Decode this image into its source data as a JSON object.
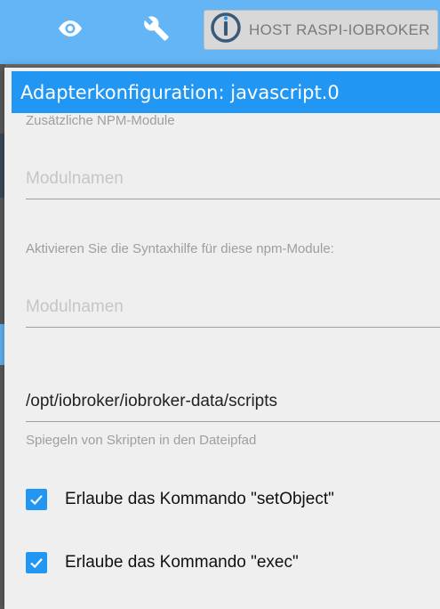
{
  "topbar": {
    "eye_icon": "eye-icon",
    "wrench_icon": "wrench-icon",
    "host_label": "HOST RASPI-IOBROKER",
    "host_logo": "iobroker-logo-icon"
  },
  "dialog": {
    "title": "Adapterkonfiguration: javascript.0",
    "npm_modules": {
      "label": "Zusätzliche NPM-Module",
      "placeholder": "Modulnamen",
      "value": ""
    },
    "syntax_help": {
      "label": "Aktivieren Sie die Syntaxhilfe für diese npm-Module:",
      "placeholder": "Modulnamen",
      "value": ""
    },
    "mirror_path": {
      "value": "/opt/iobroker/iobroker-data/scripts",
      "helper": "Spiegeln von Skripten in den Dateipfad"
    },
    "checkboxes": [
      {
        "label": "Erlaube das Kommando \"setObject\"",
        "checked": true
      },
      {
        "label": "Erlaube das Kommando \"exec\"",
        "checked": true
      }
    ]
  },
  "colors": {
    "topbar": "#64b5f6",
    "title_bar": "#2196f3",
    "checkbox": "#2196f3"
  }
}
